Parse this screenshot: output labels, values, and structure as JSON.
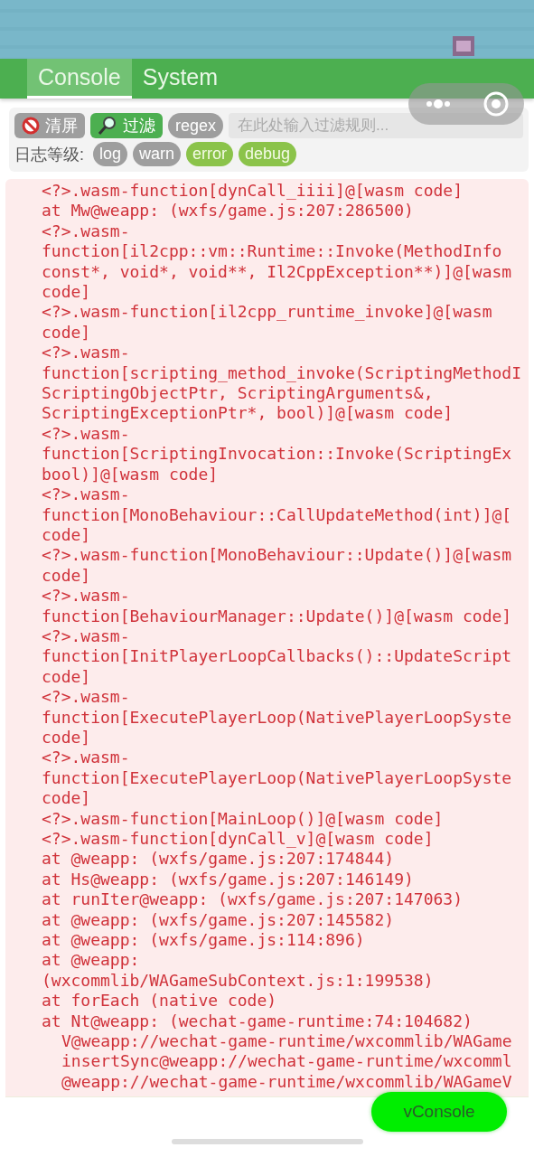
{
  "tabs": [
    {
      "label": "Console",
      "selected": true
    },
    {
      "label": "System",
      "selected": false
    }
  ],
  "toolbar": {
    "clear_button": "清屏",
    "filter_button": "过滤",
    "regex_button": "regex",
    "filter_input": {
      "placeholder": "在此处输入过滤规则..."
    }
  },
  "log_levels": {
    "label": "日志等级:",
    "levels": [
      {
        "label": "log",
        "selected": false
      },
      {
        "label": "warn",
        "selected": false
      },
      {
        "label": "error",
        "selected": true
      },
      {
        "label": "debug",
        "selected": true
      }
    ]
  },
  "log_lines": [
    {
      "text": "<?>.wasm-function[dynCall_iiii]@[wasm code]",
      "kind": "line"
    },
    {
      "text": "at Mw@weapp: (wxfs/game.js:207:286500)",
      "kind": "line"
    },
    {
      "text": "<?>.wasm-",
      "kind": "line"
    },
    {
      "text": "function[il2cpp::vm::Runtime::Invoke(MethodInfo",
      "kind": "line"
    },
    {
      "text": "const*, void*, void**, Il2CppException**)]@[wasm",
      "kind": "line"
    },
    {
      "text": "code]",
      "kind": "line"
    },
    {
      "text": "<?>.wasm-function[il2cpp_runtime_invoke]@[wasm",
      "kind": "line"
    },
    {
      "text": "code]",
      "kind": "line"
    },
    {
      "text": "<?>.wasm-",
      "kind": "line"
    },
    {
      "text": "function[scripting_method_invoke(ScriptingMethodI",
      "kind": "line"
    },
    {
      "text": "ScriptingObjectPtr, ScriptingArguments&,",
      "kind": "line"
    },
    {
      "text": "ScriptingExceptionPtr*, bool)]@[wasm code]",
      "kind": "line"
    },
    {
      "text": "<?>.wasm-",
      "kind": "line"
    },
    {
      "text": "function[ScriptingInvocation::Invoke(ScriptingEx",
      "kind": "line"
    },
    {
      "text": "bool)]@[wasm code]",
      "kind": "line"
    },
    {
      "text": "<?>.wasm-",
      "kind": "line"
    },
    {
      "text": "function[MonoBehaviour::CallUpdateMethod(int)]@[",
      "kind": "line"
    },
    {
      "text": "code]",
      "kind": "line"
    },
    {
      "text": "<?>.wasm-function[MonoBehaviour::Update()]@[wasm",
      "kind": "line"
    },
    {
      "text": "code]",
      "kind": "line"
    },
    {
      "text": "<?>.wasm-",
      "kind": "line"
    },
    {
      "text": "function[BehaviourManager::Update()]@[wasm code]",
      "kind": "line"
    },
    {
      "text": "<?>.wasm-",
      "kind": "line"
    },
    {
      "text": "function[InitPlayerLoopCallbacks()::UpdateScript",
      "kind": "line"
    },
    {
      "text": "code]",
      "kind": "line"
    },
    {
      "text": "<?>.wasm-",
      "kind": "line"
    },
    {
      "text": "function[ExecutePlayerLoop(NativePlayerLoopSyste",
      "kind": "line"
    },
    {
      "text": "code]",
      "kind": "line"
    },
    {
      "text": "<?>.wasm-",
      "kind": "line"
    },
    {
      "text": "function[ExecutePlayerLoop(NativePlayerLoopSyste",
      "kind": "line"
    },
    {
      "text": "code]",
      "kind": "line"
    },
    {
      "text": "<?>.wasm-function[MainLoop()]@[wasm code]",
      "kind": "line"
    },
    {
      "text": "<?>.wasm-function[dynCall_v]@[wasm code]",
      "kind": "line"
    },
    {
      "text": "at @weapp: (wxfs/game.js:207:174844)",
      "kind": "line"
    },
    {
      "text": "at Hs@weapp: (wxfs/game.js:207:146149)",
      "kind": "line"
    },
    {
      "text": "at runIter@weapp: (wxfs/game.js:207:147063)",
      "kind": "line"
    },
    {
      "text": "at @weapp: (wxfs/game.js:207:145582)",
      "kind": "line"
    },
    {
      "text": "at @weapp: (wxfs/game.js:114:896)",
      "kind": "line"
    },
    {
      "text": "at @weapp:",
      "kind": "line"
    },
    {
      "text": "(wxcommlib/WAGameSubContext.js:1:199538)",
      "kind": "line"
    },
    {
      "text": "at forEach (native code)",
      "kind": "line"
    },
    {
      "text": "at Nt@weapp: (wechat-game-runtime:74:104682)",
      "kind": "line"
    },
    {
      "text": "V@weapp://wechat-game-runtime/wxcommlib/WAGame",
      "kind": "nested"
    },
    {
      "text": "insertSync@weapp://wechat-game-runtime/wxcomml",
      "kind": "nested"
    },
    {
      "text": "@weapp://wechat-game-runtime/wxcommlib/WAGameV",
      "kind": "nested"
    }
  ],
  "vconsole_button": "vConsole"
}
